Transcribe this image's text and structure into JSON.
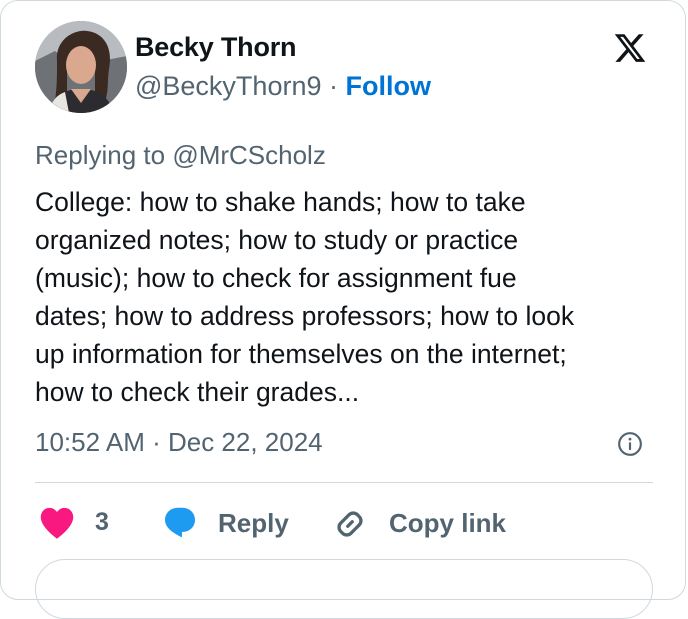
{
  "author": {
    "name": "Becky Thorn",
    "handle": "@BeckyThorn9",
    "separator": " · ",
    "follow_label": "Follow"
  },
  "reply_context": {
    "prefix": "Replying to ",
    "mention": "@MrCScholz"
  },
  "tweet": {
    "text": "College: how to shake hands; how to take\norganized notes; how to study or practice\n(music); how to check for assignment fue\ndates; how to address professors; how to look\nup information for themselves on the internet;\nhow to check their grades...",
    "timestamp": "10:52 AM · Dec 22, 2024"
  },
  "actions": {
    "like_count": "3",
    "reply_label": "Reply",
    "copy_link_label": "Copy link"
  },
  "icons": {
    "logo": "x-logo-icon",
    "info": "info-icon",
    "like": "heart-icon",
    "reply": "reply-bubble-icon",
    "copy": "link-icon"
  },
  "colors": {
    "follow_link": "#0074d4",
    "heart": "#f91880",
    "reply_bubble": "#1d9bf0",
    "secondary_text": "#536471",
    "border": "#cfd9de"
  }
}
